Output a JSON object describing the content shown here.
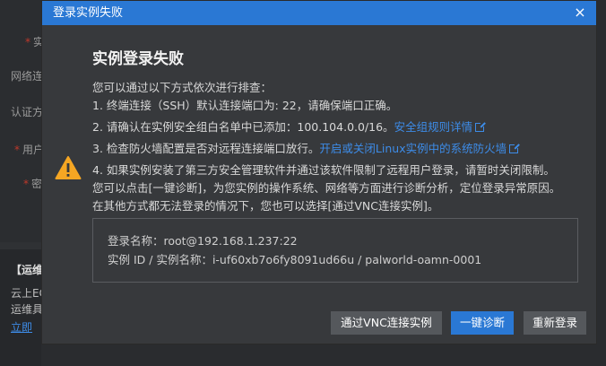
{
  "background": {
    "labels": [
      "实",
      "网络连",
      "认证方",
      "用户",
      "密"
    ],
    "lower": {
      "title": "【运维",
      "line1": "云上EC",
      "line2": "运维具",
      "link": "立即"
    }
  },
  "dialog": {
    "title": "登录实例失败",
    "close_icon": "×",
    "heading": "实例登录失败",
    "intro": "您可以通过以下方式依次进行排查：",
    "steps": [
      "1. 终端连接（SSH）默认连接端口为: 22，请确保端口正确。",
      "2. 请确认在实例安全组白名单中已添加：100.104.0.0/16。",
      "3. 检查防火墙配置是否对远程连接端口放行。",
      "4. 如果实例安装了第三方安全管理软件并通过该软件限制了远程用户登录，请暂时关闭限制。"
    ],
    "step2_link": "安全组规则详情",
    "step3_link": "开启或关闭Linux实例中的系统防火墙",
    "diagnose_note": "您可以点击[一键诊断]，为您实例的操作系统、网络等方面进行诊断分析，定位登录异常原因。",
    "vnc_note": "在其他方式都无法登录的情况下，您也可以选择[通过VNC连接实例]。",
    "info": {
      "login_name": "登录名称：root@192.168.1.237:22",
      "instance": "实例 ID / 实例名称：i-uf60xb7o6fy8091ud66u / palworld-oamn-0001"
    },
    "buttons": {
      "vnc": "通过VNC连接实例",
      "diagnose": "一键诊断",
      "relogin": "重新登录"
    }
  },
  "colors": {
    "accent": "#2a78d4",
    "link": "#3d8ce8",
    "warning": "#f5a623"
  },
  "icons": {
    "warning": "warning-triangle-icon",
    "close": "close-icon",
    "external": "external-link-icon"
  }
}
